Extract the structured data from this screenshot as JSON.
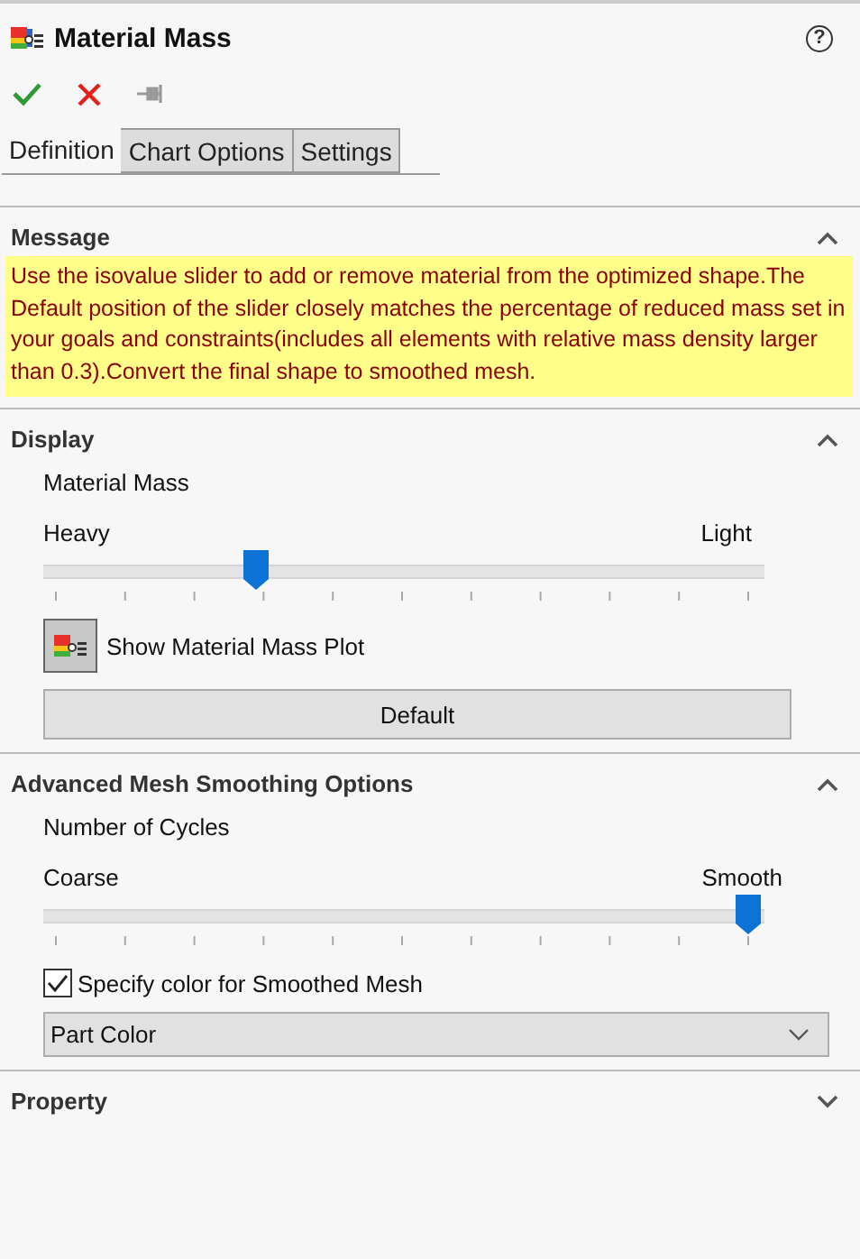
{
  "title": "Material Mass",
  "help": "?",
  "tabs": [
    {
      "label": "Definition",
      "selected": true
    },
    {
      "label": "Chart Options",
      "selected": false
    },
    {
      "label": "Settings",
      "selected": false
    }
  ],
  "sections": [
    {
      "title": "Message",
      "expanded": true,
      "kind": "message",
      "text": "Use the isovalue slider to add or remove material from the optimized shape.The Default  position of the slider closely matches the percentage of reduced mass set in your goals and constraints(includes all elements with relative mass density larger than 0.3).Convert the final shape to smoothed mesh."
    },
    {
      "title": "Display",
      "expanded": true,
      "kind": "display",
      "label": "Material Mass",
      "min_label": "Heavy",
      "max_label": "Light",
      "level": 0.29,
      "toggle": {
        "label": "Show Material Mass Plot",
        "on": true
      },
      "button": "Default"
    },
    {
      "title": "Advanced Mesh Smoothing Options",
      "expanded": true,
      "kind": "smoothing",
      "label": "Number of Cycles",
      "min_label": "Coarse",
      "max_label": "Smooth",
      "level": 1.0,
      "checkbox": {
        "label": "Specify color for Smoothed Mesh",
        "checked": true
      },
      "dropdown": {
        "value": "Part Color"
      }
    },
    {
      "title": "Property",
      "expanded": false
    }
  ]
}
